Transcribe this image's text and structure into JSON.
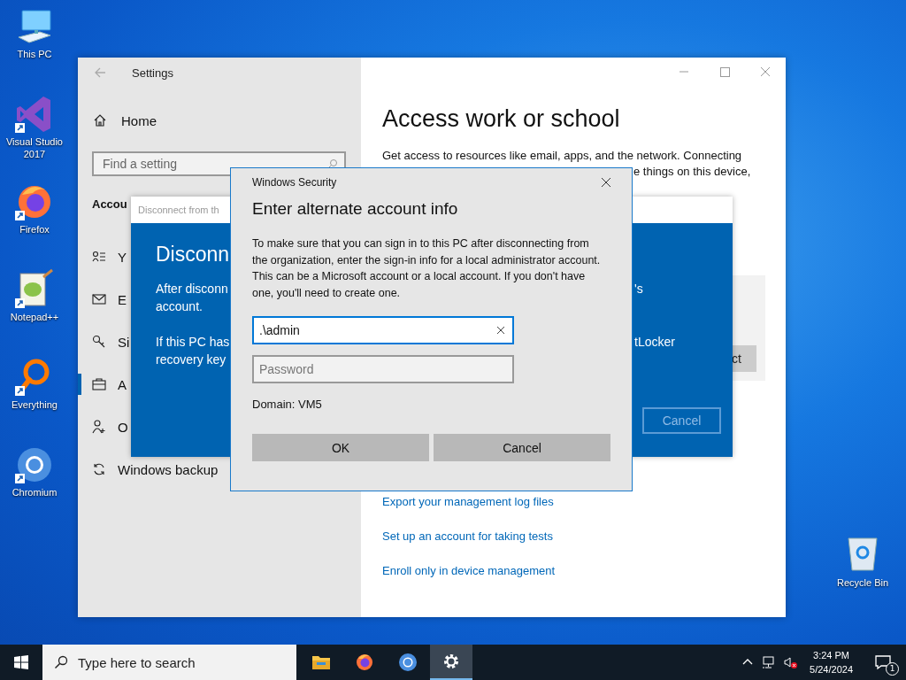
{
  "desktop_icons": [
    {
      "label": "This PC",
      "kind": "pc",
      "shortcut": false
    },
    {
      "label": "Visual Studio 2017",
      "kind": "vs",
      "shortcut": true
    },
    {
      "label": "Firefox",
      "kind": "firefox",
      "shortcut": true
    },
    {
      "label": "Notepad++",
      "kind": "notepad",
      "shortcut": true
    },
    {
      "label": "Everything",
      "kind": "everything",
      "shortcut": true
    },
    {
      "label": "Chromium",
      "kind": "chromium",
      "shortcut": true
    }
  ],
  "recycle_bin": {
    "label": "Recycle Bin"
  },
  "settings_window": {
    "title": "Settings",
    "home": "Home",
    "search_placeholder": "Find a setting",
    "section": "Accou",
    "items": [
      {
        "label": "Y",
        "selected": false
      },
      {
        "label": "E",
        "selected": false
      },
      {
        "label": "Si",
        "selected": false
      },
      {
        "label": "A",
        "selected": true
      },
      {
        "label": "O",
        "selected": false
      },
      {
        "label": "Windows backup",
        "selected": false
      }
    ],
    "heading": "Access work or school",
    "description_line": "Get access to resources like email, apps, and the network. Connecting",
    "description_fragment": "e things on this device,",
    "panel_button": "ct",
    "links": [
      "Export your management log files",
      "Set up an account for taking tests",
      "Enroll only in device management"
    ]
  },
  "disconnect_dialog": {
    "title": "Disconnect from th",
    "heading": "Disconn",
    "left_lines": [
      "After disconn",
      "account.",
      "If this PC has",
      "recovery key"
    ],
    "right_lines": [
      "'s",
      "tLocker"
    ],
    "cancel": "Cancel"
  },
  "security_dialog": {
    "title": "Windows Security",
    "heading": "Enter alternate account info",
    "message": "To make sure that you can sign in to this PC after disconnecting from the organization, enter the sign-in info for a local administrator account. This can be a Microsoft account or a local account. If you don't have one, you'll need to create one.",
    "username": {
      "value": ".\\admin",
      "focused": true
    },
    "password": {
      "placeholder": "Password"
    },
    "domain": "Domain: VM5",
    "buttons": [
      "OK",
      "Cancel"
    ]
  },
  "taskbar": {
    "search_placeholder": "Type here to search",
    "apps": [
      {
        "kind": "folder",
        "active": false
      },
      {
        "kind": "firefox",
        "active": false
      },
      {
        "kind": "chromium",
        "active": false
      },
      {
        "kind": "settings",
        "active": true
      }
    ],
    "time": "3:24 PM",
    "date": "5/24/2024",
    "notifications": "1"
  }
}
